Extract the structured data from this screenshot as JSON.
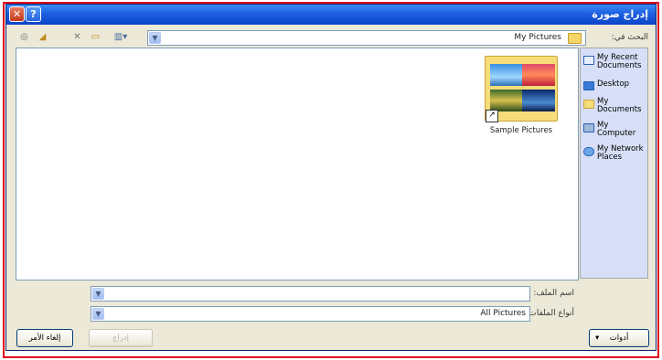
{
  "window": {
    "title": "إدراج صورة",
    "close_glyph": "✕",
    "help_glyph": "?"
  },
  "look_in": {
    "label": "البحث في:",
    "value": "My Pictures"
  },
  "toolbar": {
    "back_glyph": "◎",
    "up_glyph": "◢",
    "delete_glyph": "✕",
    "new_folder_glyph": "▭",
    "views_glyph": "▥▾"
  },
  "places": [
    {
      "label": "My Recent Documents",
      "icon": "recent-documents-icon"
    },
    {
      "label": "Desktop",
      "icon": "desktop-icon"
    },
    {
      "label": "My Documents",
      "icon": "my-documents-icon"
    },
    {
      "label": "My Computer",
      "icon": "my-computer-icon"
    },
    {
      "label": "My Network Places",
      "icon": "network-places-icon"
    }
  ],
  "files": [
    {
      "name": "Sample Pictures",
      "icon": "folder-icon"
    }
  ],
  "file_name": {
    "label": "اسم الملف:",
    "value": ""
  },
  "file_type": {
    "label": "أنواع الملفات:",
    "value": "All Pictures"
  },
  "buttons": {
    "tools": "أدوات",
    "insert": "إدراج",
    "cancel": "إلغاء الأمر"
  },
  "colors": {
    "title_bar": "#1d5fe0",
    "dialog_bg": "#ece9d8",
    "frame": "#e0001b"
  }
}
